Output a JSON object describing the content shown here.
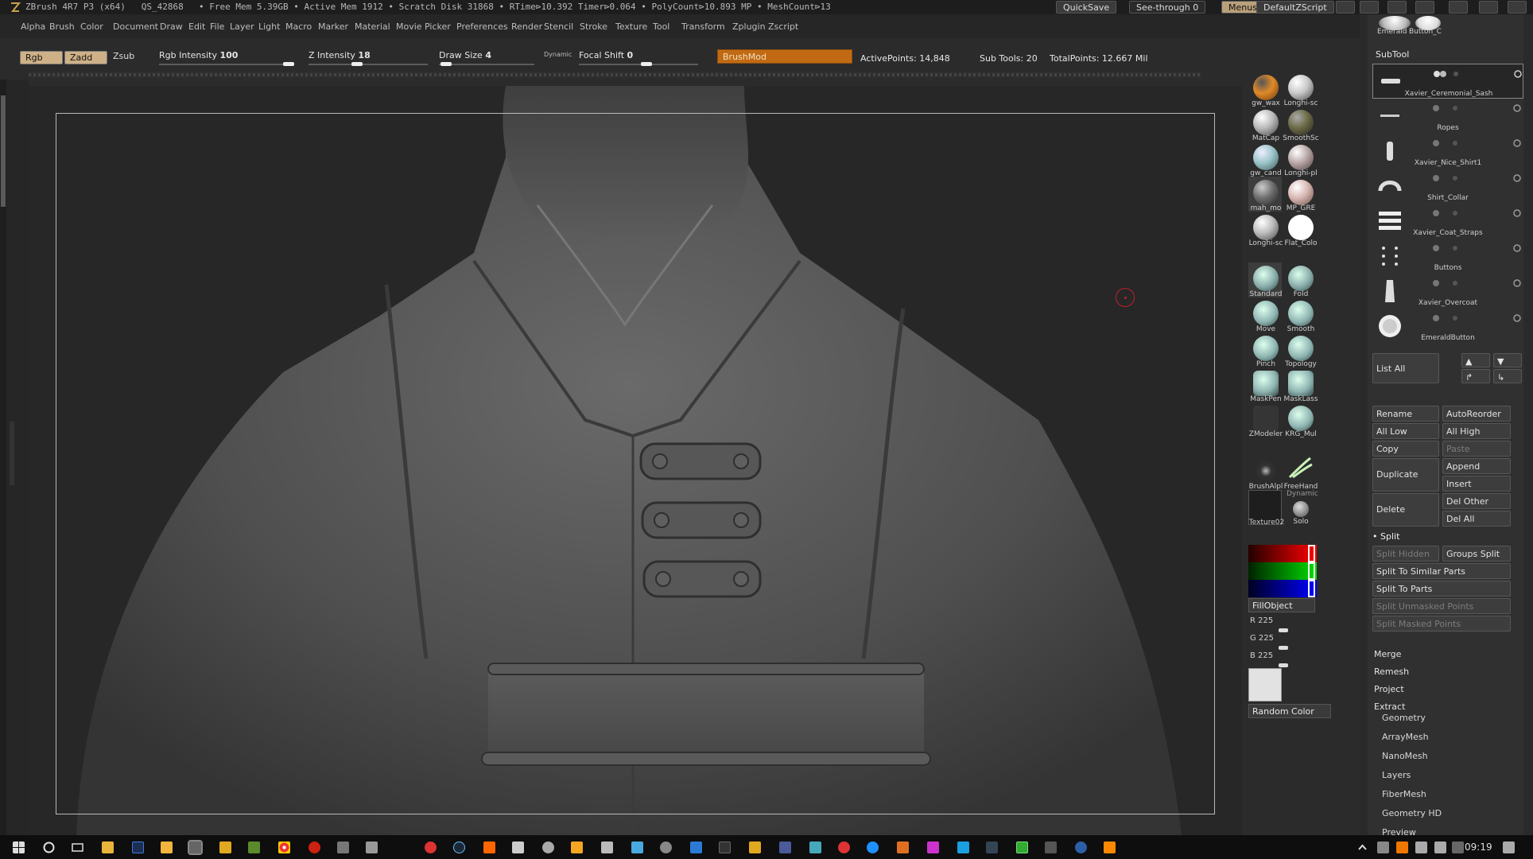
{
  "titlebar": {
    "app": "ZBrush 4R7 P3 (x64)",
    "project": "QS_42868",
    "stats": "• Free Mem 5.39GB • Active Mem 1912 • Scratch Disk 31868 • RTime⊳10.392 Timer⊳0.064 • PolyCount⊳10.893 MP • MeshCount⊳13",
    "quicksave": "QuickSave",
    "see_through": "See-through  0",
    "menus": "Menus",
    "script": "DefaultZScript"
  },
  "menubar": [
    "Alpha",
    "Brush",
    "Color",
    "Document",
    "Draw",
    "Edit",
    "File",
    "Layer",
    "Light",
    "Macro",
    "Marker",
    "Material",
    "Movie",
    "Picker",
    "Preferences",
    "Render",
    "Stencil",
    "Stroke",
    "Texture",
    "Tool",
    "Transform",
    "Zplugin",
    "Zscript"
  ],
  "topshelf": {
    "rgb": "Rgb",
    "zadd": "Zadd",
    "zsub": "Zsub",
    "rgb_intensity_label": "Rgb Intensity",
    "rgb_intensity": "100",
    "z_intensity_label": "Z Intensity",
    "z_intensity": "18",
    "draw_size_label": "Draw Size",
    "draw_size": "4",
    "dynamic": "Dynamic",
    "focal_shift_label": "Focal Shift",
    "focal_shift": "0",
    "brushmod": "BrushMod",
    "active_points": "ActivePoints: 14,848",
    "sub_tools": "Sub Tools: 20",
    "total_points": "TotalPoints: 12.667 Mil"
  },
  "materials": [
    {
      "label": "gw_wax",
      "color": "#e08a2a"
    },
    {
      "label": "Longhi-sc",
      "color": "#c9c9c9"
    },
    {
      "label": "MatCap",
      "color": "#b9b9b9"
    },
    {
      "label": "SmoothSc",
      "color": "#6b6a45"
    },
    {
      "label": "gw_cand",
      "color": "#9bc5c9"
    },
    {
      "label": "Longhi-pl",
      "color": "#b9a7a7"
    },
    {
      "label": "mah_mo",
      "color": "#6e6e6e"
    },
    {
      "label": "MP_GRE",
      "color": "#d8b7b2"
    },
    {
      "label": "Longhi-sc",
      "color": "#bdbdbd"
    },
    {
      "label": "Flat_Colo",
      "color": "#ffffff"
    }
  ],
  "brushes": [
    {
      "label": "Standard",
      "color": "#86aaa8"
    },
    {
      "label": "Fold",
      "color": "#86aaa8"
    },
    {
      "label": "Move",
      "color": "#8fb5b2"
    },
    {
      "label": "Smooth",
      "color": "#8fb5b2"
    },
    {
      "label": "Pinch",
      "color": "#8fb5b2"
    },
    {
      "label": "Topology",
      "color": "#8fb5b2"
    },
    {
      "label": "MaskPen",
      "color": "#8fb5b2"
    },
    {
      "label": "MaskLass",
      "color": "#8fb5b2"
    },
    {
      "label": "ZModeler",
      "color": "#3a3a3a"
    },
    {
      "label": "KRG_Mul",
      "color": "#8fb5b2"
    }
  ],
  "stroke": {
    "alpha_label": "BrushAlpl",
    "freehand_label": "FreeHand",
    "texture_label": "Texture02",
    "dynamic_label": "Dynamic",
    "solo_label": "Solo"
  },
  "color": {
    "fill_object": "FillObject",
    "r": "R 225",
    "g": "G 225",
    "b": "B 225",
    "random_color": "Random Color",
    "swatch_hex": "#e1e1e1"
  },
  "subtool_panel": {
    "top_labels": [
      "Emerald",
      "Button_C"
    ],
    "title": "SubTool",
    "items": [
      {
        "name": "Xavier_Ceremonial_Sash"
      },
      {
        "name": "Ropes"
      },
      {
        "name": "Xavier_Nice_Shirt1"
      },
      {
        "name": "Shirt_Collar"
      },
      {
        "name": "Xavier_Coat_Straps"
      },
      {
        "name": "Buttons"
      },
      {
        "name": "Xavier_Overcoat"
      },
      {
        "name": "EmeraldButton"
      }
    ],
    "list_all": "List All",
    "rename": "Rename",
    "autoreorder": "AutoReorder",
    "all_low": "All Low",
    "all_high": "All High",
    "copy": "Copy",
    "paste": "Paste",
    "duplicate": "Duplicate",
    "append": "Append",
    "insert": "Insert",
    "delete": "Delete",
    "del_other": "Del Other",
    "del_all": "Del All",
    "split": "Split",
    "split_hidden": "Split Hidden",
    "groups_split": "Groups Split",
    "split_similar": "Split To Similar Parts",
    "split_parts": "Split To Parts",
    "split_unmasked": "Split Unmasked Points",
    "split_masked": "Split Masked Points",
    "merge": "Merge",
    "remesh": "Remesh",
    "project": "Project",
    "extract": "Extract",
    "sections": [
      "Geometry",
      "ArrayMesh",
      "NanoMesh",
      "Layers",
      "FiberMesh",
      "Geometry HD",
      "Preview"
    ]
  },
  "taskbar": {
    "time": "09:19"
  }
}
